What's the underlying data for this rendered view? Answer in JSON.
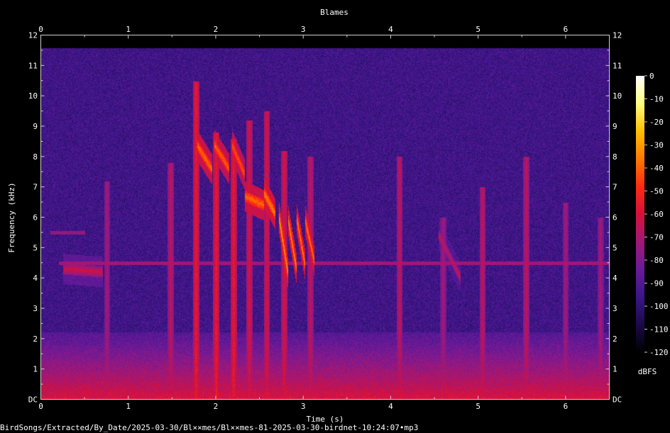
{
  "chart_data": {
    "type": "heatmap",
    "title": "Blames",
    "xlabel": "Time (s)",
    "ylabel": "Frequency (kHz)",
    "xlim": [
      0,
      6.5
    ],
    "ylim": [
      0,
      12
    ],
    "x_ticks": [
      "0",
      "1",
      "2",
      "3",
      "4",
      "5",
      "6"
    ],
    "y_ticks": [
      "DC",
      "1",
      "2",
      "3",
      "4",
      "5",
      "6",
      "7",
      "8",
      "9",
      "10",
      "11",
      "12"
    ],
    "colorbar": {
      "label": "dBFS",
      "range": [
        -120,
        0
      ],
      "ticks": [
        "0",
        "-10",
        "-20",
        "-30",
        "-40",
        "-50",
        "-60",
        "-70",
        "-80",
        "-90",
        "-100",
        "-110",
        "-120"
      ],
      "colormap": [
        "#000000",
        "#1a0a4a",
        "#3a168a",
        "#6a1a9a",
        "#a01878",
        "#d8103a",
        "#ff2a10",
        "#ff7a00",
        "#ffc000",
        "#ffff80",
        "#ffffff"
      ]
    },
    "noise_floor_dbfs": -95,
    "low_band": {
      "freq_khz": [
        0,
        2.2
      ],
      "level_dbfs": -60
    },
    "clicks": [
      {
        "t": 0.75,
        "f_khz": [
          0,
          7.2
        ],
        "level_dbfs": -70
      },
      {
        "t": 1.48,
        "f_khz": [
          0,
          7.8
        ],
        "level_dbfs": -65
      },
      {
        "t": 1.77,
        "f_khz": [
          0,
          10.5
        ],
        "level_dbfs": -55
      },
      {
        "t": 2.0,
        "f_khz": [
          0,
          8.8
        ],
        "level_dbfs": -55
      },
      {
        "t": 2.2,
        "f_khz": [
          0,
          8.6
        ],
        "level_dbfs": -55
      },
      {
        "t": 2.38,
        "f_khz": [
          0,
          9.2
        ],
        "level_dbfs": -60
      },
      {
        "t": 2.58,
        "f_khz": [
          0,
          9.5
        ],
        "level_dbfs": -60
      },
      {
        "t": 2.78,
        "f_khz": [
          0,
          8.2
        ],
        "level_dbfs": -60
      },
      {
        "t": 3.08,
        "f_khz": [
          0,
          8.0
        ],
        "level_dbfs": -65
      },
      {
        "t": 4.1,
        "f_khz": [
          0,
          8.0
        ],
        "level_dbfs": -65
      },
      {
        "t": 4.6,
        "f_khz": [
          0,
          6.0
        ],
        "level_dbfs": -70
      },
      {
        "t": 5.05,
        "f_khz": [
          0,
          7.0
        ],
        "level_dbfs": -65
      },
      {
        "t": 5.55,
        "f_khz": [
          0,
          8.0
        ],
        "level_dbfs": -65
      },
      {
        "t": 6.0,
        "f_khz": [
          0,
          6.5
        ],
        "level_dbfs": -70
      },
      {
        "t": 6.4,
        "f_khz": [
          0,
          6.0
        ],
        "level_dbfs": -70
      }
    ],
    "calls": [
      {
        "t0": 1.78,
        "t1": 1.95,
        "f0_khz": 8.4,
        "f1_khz": 7.6,
        "level_dbfs": -38
      },
      {
        "t0": 1.98,
        "t1": 2.15,
        "f0_khz": 8.4,
        "f1_khz": 7.6,
        "level_dbfs": -40
      },
      {
        "t0": 2.18,
        "t1": 2.33,
        "f0_khz": 8.4,
        "f1_khz": 7.4,
        "level_dbfs": -42
      },
      {
        "t0": 2.33,
        "t1": 2.55,
        "f0_khz": 6.7,
        "f1_khz": 6.4,
        "level_dbfs": -38
      },
      {
        "t0": 2.55,
        "t1": 2.68,
        "f0_khz": 6.8,
        "f1_khz": 6.1,
        "level_dbfs": -35
      },
      {
        "t0": 2.72,
        "t1": 2.82,
        "f0_khz": 6.0,
        "f1_khz": 4.2,
        "level_dbfs": -30
      },
      {
        "t0": 2.82,
        "t1": 2.92,
        "f0_khz": 6.0,
        "f1_khz": 4.3,
        "level_dbfs": -32
      },
      {
        "t0": 2.92,
        "t1": 3.02,
        "f0_khz": 6.0,
        "f1_khz": 4.4,
        "level_dbfs": -34
      },
      {
        "t0": 3.02,
        "t1": 3.12,
        "f0_khz": 5.9,
        "f1_khz": 4.6,
        "level_dbfs": -36
      },
      {
        "t0": 0.25,
        "t1": 0.7,
        "f0_khz": 4.3,
        "f1_khz": 4.2,
        "level_dbfs": -62
      },
      {
        "t0": 4.55,
        "t1": 4.8,
        "f0_khz": 5.4,
        "f1_khz": 4.0,
        "level_dbfs": -65
      }
    ],
    "hum_lines": [
      {
        "f_khz": 4.5,
        "t0": 0.2,
        "t1": 6.5,
        "level_dbfs": -72
      },
      {
        "f_khz": 5.5,
        "t0": 0.1,
        "t1": 0.5,
        "level_dbfs": -75
      }
    ]
  },
  "file_label": "BirdSongs/Extracted/By_Date/2025-03-30/Bl××mes/Bl××mes-81-2025-03-30-birdnet-10:24:07•mp3"
}
